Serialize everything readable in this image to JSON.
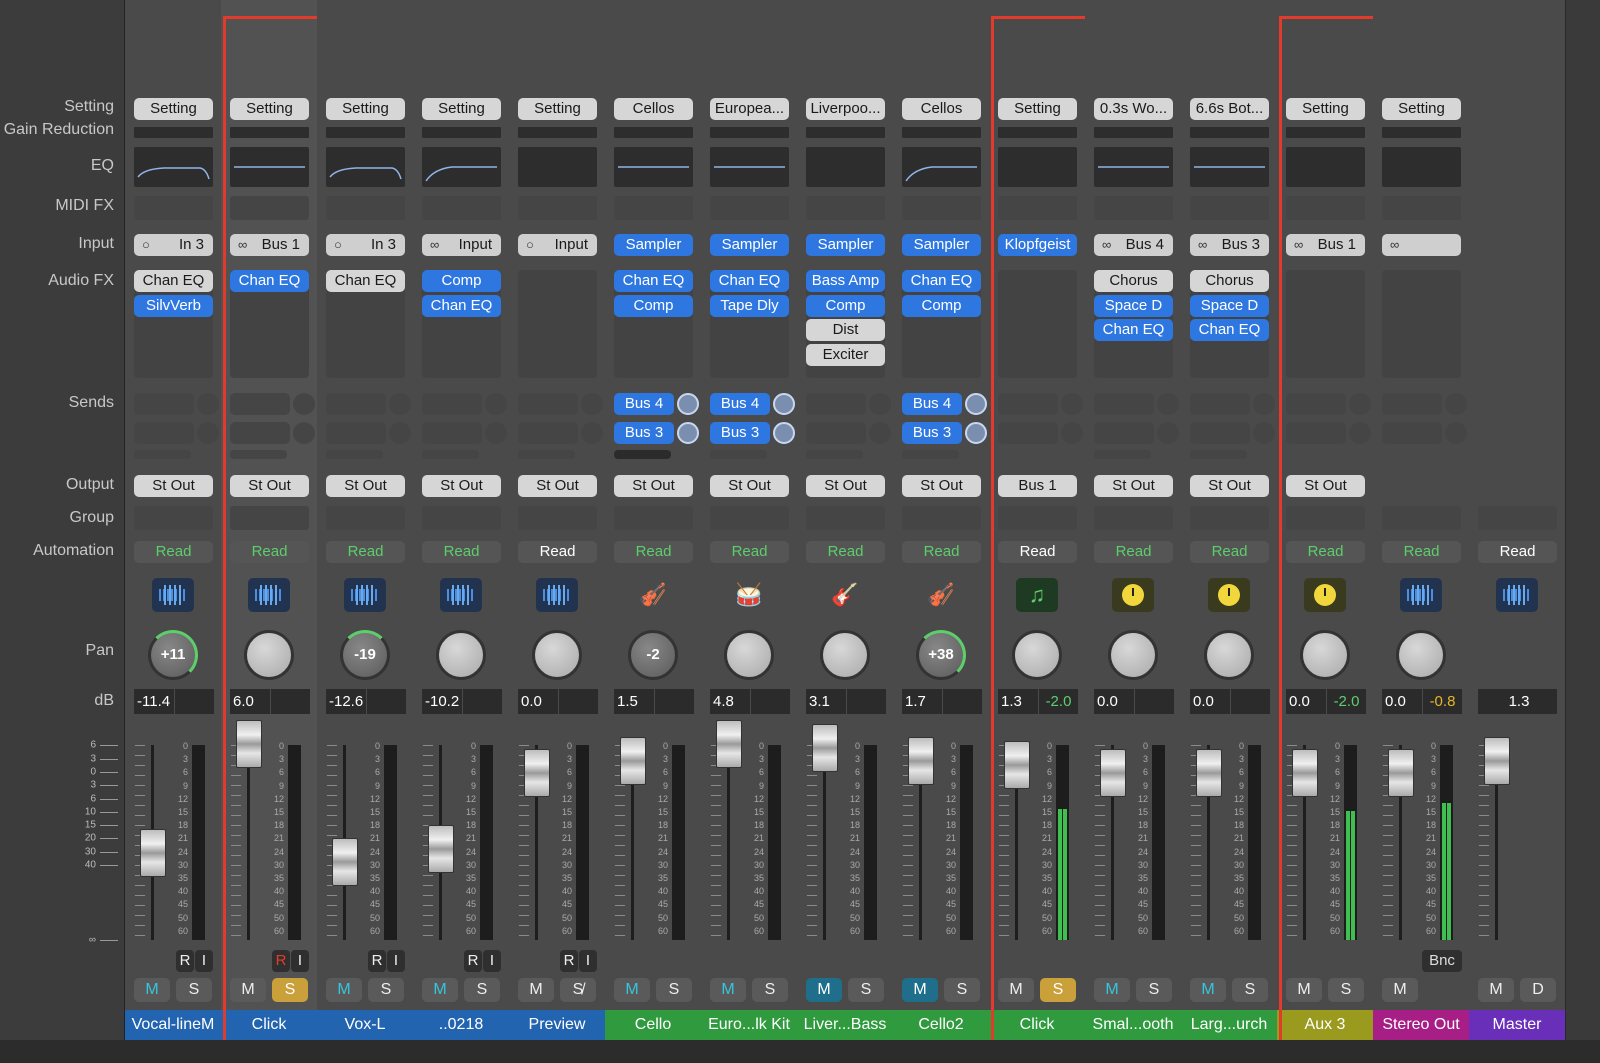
{
  "row_labels": {
    "setting": "Setting",
    "gain_reduction": "Gain Reduction",
    "eq": "EQ",
    "midi_fx": "MIDI FX",
    "input": "Input",
    "audio_fx": "Audio FX",
    "sends": "Sends",
    "output": "Output",
    "group": "Group",
    "automation": "Automation",
    "pan": "Pan",
    "db": "dB"
  },
  "left_scale": [
    "6",
    "3",
    "0",
    "3",
    "6",
    "10",
    "15",
    "20",
    "30",
    "40",
    "∞"
  ],
  "meter_scale": [
    "0",
    "3",
    "6",
    "9",
    "12",
    "15",
    "18",
    "21",
    "24",
    "30",
    "35",
    "40",
    "45",
    "50",
    "60"
  ],
  "colors": {
    "outline": "#e23b2b",
    "blue_plugin": "#2f77e0",
    "automation_green": "#5ccf6b",
    "peak_yellow": "#e8b52a"
  },
  "strips": [
    {
      "name": "Vocal-lineM",
      "color": "#2364b0",
      "setting": "Setting",
      "eq": "shelf",
      "input": "In 3",
      "input_icon": "○",
      "input_blue": false,
      "fx": [
        {
          "l": "Chan EQ",
          "b": false
        },
        {
          "l": "SilvVerb",
          "b": true
        }
      ],
      "sends": [],
      "send_bar": true,
      "output": "St Out",
      "auto": "Read",
      "auto_green": true,
      "icon": "waveform-icon",
      "pan": "+11",
      "pan_arc": "R",
      "db": "-11.4",
      "peak": "",
      "fader": 0.52,
      "ri": true,
      "ms": [
        "M",
        "S"
      ],
      "m_style": "cyan",
      "s_style": "",
      "selected": false,
      "outlined": false,
      "meter": 0
    },
    {
      "name": "Click",
      "color": "#2364b0",
      "setting": "Setting",
      "eq": "flat",
      "input": "Bus 1",
      "input_icon": "∞",
      "input_blue": false,
      "fx": [
        {
          "l": "Chan EQ",
          "b": true
        }
      ],
      "sends": [],
      "send_bar": true,
      "output": "St Out",
      "auto": "Read",
      "auto_green": true,
      "icon": "waveform-icon",
      "pan": "",
      "pan_arc": "",
      "db": "6.0",
      "peak": "",
      "fader": 0.0,
      "ri": true,
      "ri_red": true,
      "ms": [
        "M",
        "S"
      ],
      "m_style": "",
      "s_style": "solo",
      "selected": true,
      "outlined": true,
      "meter": 0
    },
    {
      "name": "Vox-L",
      "color": "#2364b0",
      "setting": "Setting",
      "eq": "shelf",
      "input": "In 3",
      "input_icon": "○",
      "input_blue": false,
      "fx": [
        {
          "l": "Chan EQ",
          "b": false
        }
      ],
      "sends": [],
      "send_bar": true,
      "output": "St Out",
      "auto": "Read",
      "auto_green": true,
      "icon": "waveform-icon",
      "pan": "-19",
      "pan_arc": "L",
      "db": "-12.6",
      "peak": "",
      "fader": 0.56,
      "ri": true,
      "ms": [
        "M",
        "S"
      ],
      "m_style": "cyan",
      "s_style": "",
      "selected": false,
      "outlined": false,
      "meter": 0
    },
    {
      "name": "..0218",
      "color": "#2364b0",
      "setting": "Setting",
      "eq": "hp",
      "input": "Input",
      "input_icon": "∞",
      "input_blue": false,
      "fx": [
        {
          "l": "Comp",
          "b": true
        },
        {
          "l": "Chan EQ",
          "b": true
        }
      ],
      "sends": [],
      "send_bar": true,
      "output": "St Out",
      "auto": "Read",
      "auto_green": true,
      "icon": "waveform-icon",
      "pan": "",
      "pan_arc": "",
      "db": "-10.2",
      "peak": "",
      "fader": 0.5,
      "ri": true,
      "ms": [
        "M",
        "S"
      ],
      "m_style": "cyan",
      "s_style": "",
      "selected": false,
      "outlined": false,
      "meter": 0
    },
    {
      "name": "Preview",
      "color": "#2364b0",
      "setting": "Setting",
      "eq": "none",
      "input": "Input",
      "input_icon": "○",
      "input_blue": false,
      "fx": [],
      "sends": [],
      "send_bar": true,
      "output": "St Out",
      "auto": "Read",
      "auto_green": false,
      "icon": "waveform-icon",
      "pan": "",
      "pan_arc": "",
      "db": "0.0",
      "peak": "",
      "fader": 0.14,
      "ri": true,
      "ms": [
        "M",
        "S̸"
      ],
      "m_style": "",
      "s_style": "",
      "selected": false,
      "outlined": false,
      "meter": 0
    },
    {
      "name": "Cello",
      "color": "#2f9a3e",
      "setting": "Cellos",
      "eq": "flat",
      "input": "Sampler",
      "input_icon": "",
      "input_blue": true,
      "fx": [
        {
          "l": "Chan EQ",
          "b": true
        },
        {
          "l": "Comp",
          "b": true
        }
      ],
      "sends": [
        "Bus 4",
        "Bus 3"
      ],
      "send_bar": true,
      "send_bar_dark": true,
      "output": "St Out",
      "auto": "Read",
      "auto_green": true,
      "icon": "cello-icon",
      "pan": "-2",
      "pan_arc": "",
      "db": "1.5",
      "peak": "",
      "fader": 0.08,
      "ri": false,
      "ms": [
        "M",
        "S"
      ],
      "m_style": "cyan",
      "s_style": "",
      "selected": false,
      "outlined": false,
      "meter": 0
    },
    {
      "name": "Euro...lk Kit",
      "color": "#2f9a3e",
      "setting": "Europea...",
      "eq": "flat",
      "input": "Sampler",
      "input_icon": "",
      "input_blue": true,
      "fx": [
        {
          "l": "Chan EQ",
          "b": true
        },
        {
          "l": "Tape Dly",
          "b": true
        }
      ],
      "sends": [
        "Bus 4",
        "Bus 3"
      ],
      "send_bar": true,
      "output": "St Out",
      "auto": "Read",
      "auto_green": true,
      "icon": "drum-icon",
      "pan": "",
      "pan_arc": "",
      "db": "4.8",
      "peak": "",
      "fader": 0.0,
      "ri": false,
      "ms": [
        "M",
        "S"
      ],
      "m_style": "cyan",
      "s_style": "",
      "selected": false,
      "outlined": false,
      "meter": 0
    },
    {
      "name": "Liver...Bass",
      "color": "#2f9a3e",
      "setting": "Liverpoo...",
      "eq": "none",
      "input": "Sampler",
      "input_icon": "",
      "input_blue": true,
      "fx": [
        {
          "l": "Bass Amp",
          "b": true
        },
        {
          "l": "Comp",
          "b": true
        },
        {
          "l": "Dist",
          "b": false
        },
        {
          "l": "Exciter",
          "b": false
        }
      ],
      "sends": [],
      "send_bar": true,
      "output": "St Out",
      "auto": "Read",
      "auto_green": true,
      "icon": "guitar-icon",
      "pan": "",
      "pan_arc": "",
      "db": "3.1",
      "peak": "",
      "fader": 0.02,
      "ri": false,
      "ms": [
        "M",
        "S"
      ],
      "m_style": "mon",
      "s_style": "",
      "selected": false,
      "outlined": false,
      "meter": 0
    },
    {
      "name": "Cello2",
      "color": "#2f9a3e",
      "setting": "Cellos",
      "eq": "hp",
      "input": "Sampler",
      "input_icon": "",
      "input_blue": true,
      "fx": [
        {
          "l": "Chan EQ",
          "b": true
        },
        {
          "l": "Comp",
          "b": true
        }
      ],
      "sends": [
        "Bus 4",
        "Bus 3"
      ],
      "send_bar": true,
      "output": "St Out",
      "auto": "Read",
      "auto_green": true,
      "icon": "cello-icon",
      "pan": "+38",
      "pan_arc": "R",
      "db": "1.7",
      "peak": "",
      "fader": 0.08,
      "ri": false,
      "ms": [
        "M",
        "S"
      ],
      "m_style": "mon",
      "s_style": "",
      "selected": false,
      "outlined": false,
      "meter": 0
    },
    {
      "name": "Click",
      "color": "#2f9a3e",
      "setting": "Setting",
      "eq": "none",
      "input": "Klopfgeist",
      "input_icon": "",
      "input_blue": true,
      "fx": [],
      "sends": [],
      "send_bar": false,
      "output": "Bus 1",
      "auto": "Read",
      "auto_green": false,
      "icon": "music-note-icon",
      "pan": "",
      "pan_arc": "",
      "db": "1.3",
      "peak": "-2.0",
      "peak_color": "g",
      "fader": 0.1,
      "ri": false,
      "ms": [
        "M",
        "S"
      ],
      "m_style": "",
      "s_style": "solo",
      "selected": false,
      "outlined": true,
      "meter": 0.67
    },
    {
      "name": "Smal...ooth",
      "color": "#2f9a3e",
      "setting": "0.3s Wo...",
      "eq": "flat",
      "input": "Bus 4",
      "input_icon": "∞",
      "input_blue": false,
      "fx": [
        {
          "l": "Chorus",
          "b": false
        },
        {
          "l": "Space D",
          "b": true
        },
        {
          "l": "Chan EQ",
          "b": true
        }
      ],
      "sends": [],
      "send_bar": true,
      "output": "St Out",
      "auto": "Read",
      "auto_green": true,
      "icon": "clock-icon",
      "pan": "",
      "pan_arc": "",
      "db": "0.0",
      "peak": "",
      "fader": 0.14,
      "ri": false,
      "ms": [
        "M",
        "S"
      ],
      "m_style": "cyan",
      "s_style": "",
      "selected": false,
      "outlined": false,
      "meter": 0
    },
    {
      "name": "Larg...urch",
      "color": "#2f9a3e",
      "setting": "6.6s Bot...",
      "eq": "flat",
      "input": "Bus 3",
      "input_icon": "∞",
      "input_blue": false,
      "fx": [
        {
          "l": "Chorus",
          "b": false
        },
        {
          "l": "Space D",
          "b": true
        },
        {
          "l": "Chan EQ",
          "b": true
        }
      ],
      "sends": [],
      "send_bar": true,
      "output": "St Out",
      "auto": "Read",
      "auto_green": true,
      "icon": "clock-icon",
      "pan": "",
      "pan_arc": "",
      "db": "0.0",
      "peak": "",
      "fader": 0.14,
      "ri": false,
      "ms": [
        "M",
        "S"
      ],
      "m_style": "cyan",
      "s_style": "",
      "selected": false,
      "outlined": false,
      "meter": 0
    },
    {
      "name": "Aux 3",
      "color": "#9a9a1e",
      "setting": "Setting",
      "eq": "none",
      "input": "Bus 1",
      "input_icon": "∞",
      "input_blue": false,
      "fx": [],
      "sends": [],
      "send_bar": false,
      "output": "St Out",
      "auto": "Read",
      "auto_green": true,
      "icon": "clock-icon",
      "pan": "",
      "pan_arc": "",
      "db": "0.0",
      "peak": "-2.0",
      "peak_color": "g",
      "fader": 0.14,
      "ri": false,
      "ms": [
        "M",
        "S"
      ],
      "m_style": "",
      "s_style": "",
      "selected": false,
      "outlined": true,
      "meter": 0.66
    },
    {
      "name": "Stereo Out",
      "color": "#a61e86",
      "setting": "Setting",
      "eq": "none",
      "input": "",
      "input_icon": "∞",
      "input_blue": false,
      "fx": [],
      "sends": [],
      "send_bar": false,
      "output": "",
      "auto": "Read",
      "auto_green": true,
      "icon": "waveform-icon",
      "pan": "",
      "pan_arc": "",
      "db": "0.0",
      "peak": "-0.8",
      "peak_color": "y",
      "fader": 0.14,
      "ri": false,
      "bnc": "Bnc",
      "ms": [
        "M"
      ],
      "m_style": "",
      "s_style": "",
      "selected": false,
      "outlined": false,
      "meter": 0.7
    },
    {
      "name": "Master",
      "color": "#6a2fb8",
      "setting": "",
      "eq": "none",
      "input": "",
      "input_icon": "",
      "input_blue": false,
      "fx": [],
      "sends": [],
      "send_bar": false,
      "output": "",
      "auto": "Read",
      "auto_green": false,
      "icon": "waveform-icon",
      "pan": "",
      "pan_arc": "",
      "db": "1.3",
      "peak": "",
      "fader": 0.08,
      "ri": false,
      "ms": [
        "M",
        "D"
      ],
      "m_style": "",
      "s_style": "",
      "selected": false,
      "outlined": false,
      "meter": 0,
      "master": true
    }
  ]
}
